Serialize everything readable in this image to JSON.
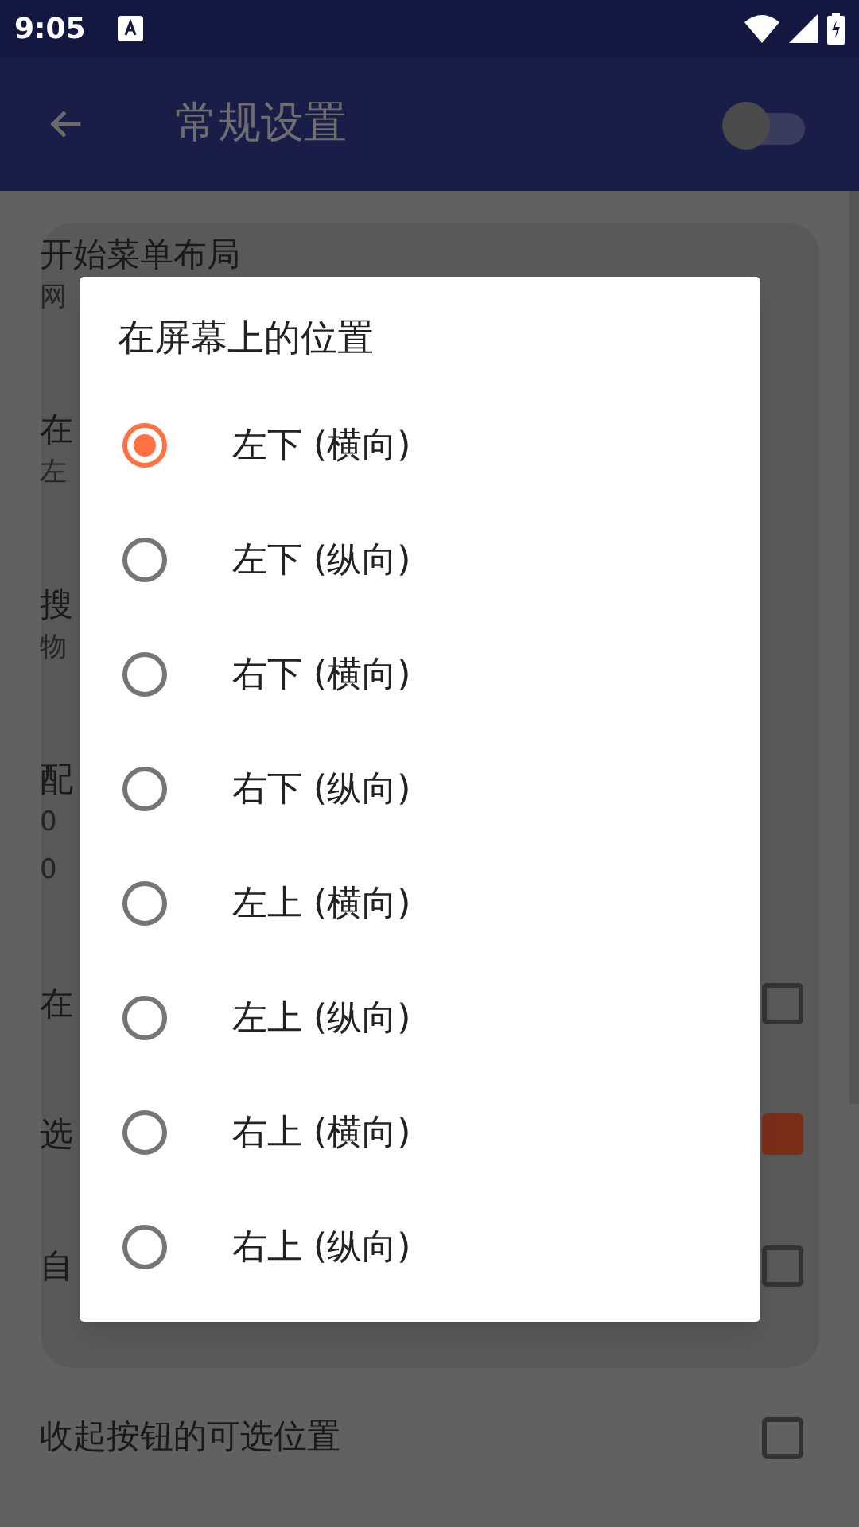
{
  "status_bar": {
    "time": "9:05"
  },
  "app_bar": {
    "title": "常规设置",
    "switch_on": false
  },
  "settings_card": [
    {
      "title": "开始菜单布局",
      "lines": [
        "网"
      ]
    },
    {
      "title": "在",
      "lines": [
        "左"
      ]
    },
    {
      "title": "搜",
      "lines": [
        "物"
      ]
    },
    {
      "title": "配",
      "lines": [
        "0",
        "0"
      ]
    },
    {
      "title": "在",
      "checked": false
    },
    {
      "title": "选",
      "checked": true
    },
    {
      "title": "自",
      "checked": false
    }
  ],
  "settings": [
    {
      "title": "收起按钮的可选位置",
      "checked": false
    }
  ],
  "dialog": {
    "title": "在屏幕上的位置",
    "options": [
      {
        "label": "左下 (横向)",
        "selected": true
      },
      {
        "label": "左下 (纵向)",
        "selected": false
      },
      {
        "label": "右下 (横向)",
        "selected": false
      },
      {
        "label": "右下 (纵向)",
        "selected": false
      },
      {
        "label": "左上 (横向)",
        "selected": false
      },
      {
        "label": "左上 (纵向)",
        "selected": false
      },
      {
        "label": "右上 (横向)",
        "selected": false
      },
      {
        "label": "右上 (纵向)",
        "selected": false
      }
    ]
  }
}
